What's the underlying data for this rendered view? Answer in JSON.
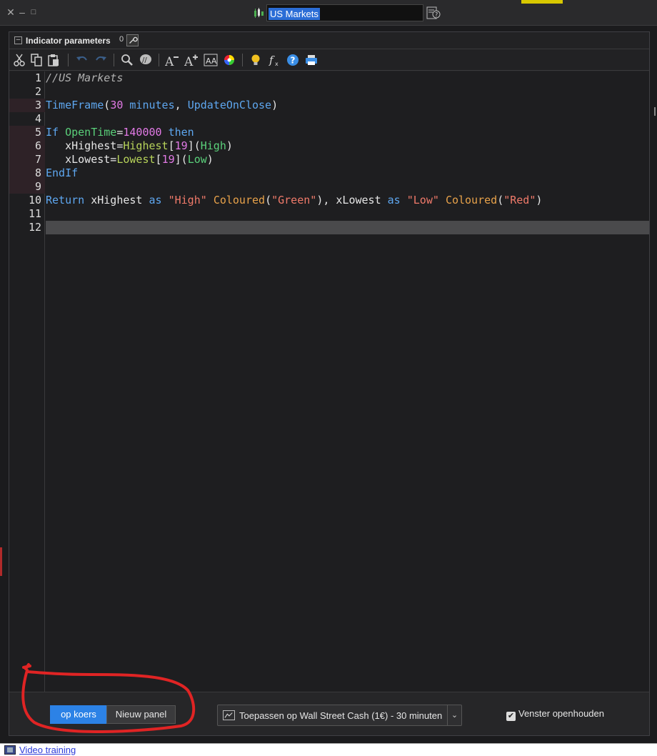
{
  "titlebar": {
    "title": "US Markets"
  },
  "panel": {
    "title": "Indicator parameters",
    "count": "0"
  },
  "toolbar": {
    "buttons": [
      "cut-icon",
      "copy-icon",
      "paste-icon",
      "undo-icon",
      "redo-icon",
      "search-icon",
      "comment-icon",
      "font-decrease-icon",
      "font-increase-icon",
      "font-style-icon",
      "color-wheel-icon",
      "lightbulb-icon",
      "function-icon",
      "help-icon",
      "print-icon"
    ]
  },
  "editor": {
    "line_numbers": [
      "1",
      "2",
      "3",
      "4",
      "5",
      "6",
      "7",
      "8",
      "9",
      "10",
      "11",
      "12"
    ],
    "lines": [
      {
        "t1": "//US Markets"
      },
      {},
      {
        "t1": "TimeFrame",
        "t2": "(",
        "t3": "30",
        "t4": " minutes",
        "t5": ", ",
        "t6": "UpdateOnClose",
        "t7": ")"
      },
      {},
      {
        "t1": "If",
        "t2": " ",
        "t3": "OpenTime",
        "t4": "=",
        "t5": "140000",
        "t6": " then"
      },
      {
        "t1": "   xHighest=",
        "t2": "Highest",
        "t3": "[",
        "t4": "19",
        "t5": "](",
        "t6": "High",
        "t7": ")"
      },
      {
        "t1": "   xLowest=",
        "t2": "Lowest",
        "t3": "[",
        "t4": "19",
        "t5": "](",
        "t6": "Low",
        "t7": ")"
      },
      {
        "t1": "EndIf"
      },
      {},
      {
        "t1": "Return",
        "t2": " xHighest ",
        "t3": "as",
        "t4": " ",
        "t5": "\"High\"",
        "t6": " ",
        "t7": "Coloured",
        "t8": "(",
        "t9": "\"Green\"",
        "t10": "), xLowest ",
        "t11": "as",
        "t12": " ",
        "t13": "\"Low\"",
        "t14": " ",
        "t15": "Coloured",
        "t16": "(",
        "t17": "\"Red\"",
        "t18": ")"
      },
      {},
      {}
    ]
  },
  "bottom": {
    "seg_active": "op koers",
    "seg_other": "Nieuw panel",
    "apply_label": "Toepassen op Wall Street Cash (1€) - 30 minuten",
    "keep_open": "Venster openhouden",
    "keep_open_checked": true
  },
  "footer": {
    "video_link": "Video training"
  },
  "colors": {
    "accent": "#2c82e6",
    "annotation": "#e02424"
  }
}
